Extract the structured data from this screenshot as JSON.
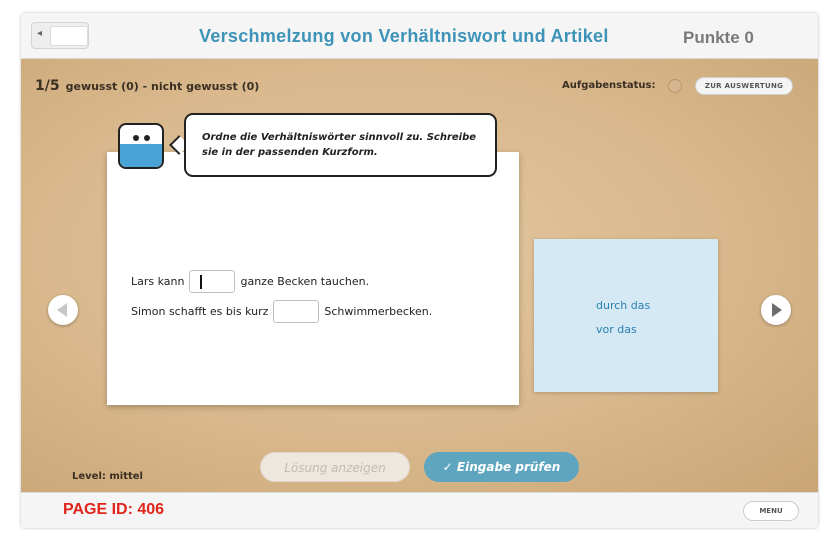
{
  "header": {
    "back_icon": "◂",
    "title": "Verschmelzung von Verhältniswort und Artikel",
    "score": "Punkte 0"
  },
  "exercise": {
    "progress_number": "1/5",
    "progress_text": "gewusst (0) - nicht gewusst (0)",
    "status_label": "Aufgabenstatus:",
    "evaluation_button": "ZUR AUSWERTUNG",
    "instruction": "Ordne die Verhältniswörter sinnvoll zu. Schreibe sie in der passenden Kurzform.",
    "sentences": [
      {
        "before": "Lars kann",
        "after": "ganze Becken tauchen."
      },
      {
        "before": "Simon schafft es bis kurz",
        "after": "Schwimmerbecken."
      }
    ],
    "word_bank": [
      "durch das",
      "vor das"
    ],
    "level": "Level: mittel",
    "show_solution_button": "Lösung anzeigen",
    "check_button": "Eingabe prüfen",
    "check_icon": "✓"
  },
  "footer": {
    "page_id": "PAGE ID: 406",
    "menu_button": "MENU"
  },
  "colors": {
    "title": "#3d93b8",
    "accent_button": "#5ea6c0",
    "page_id": "#e1251b",
    "word_box": "#d4e9f4"
  }
}
